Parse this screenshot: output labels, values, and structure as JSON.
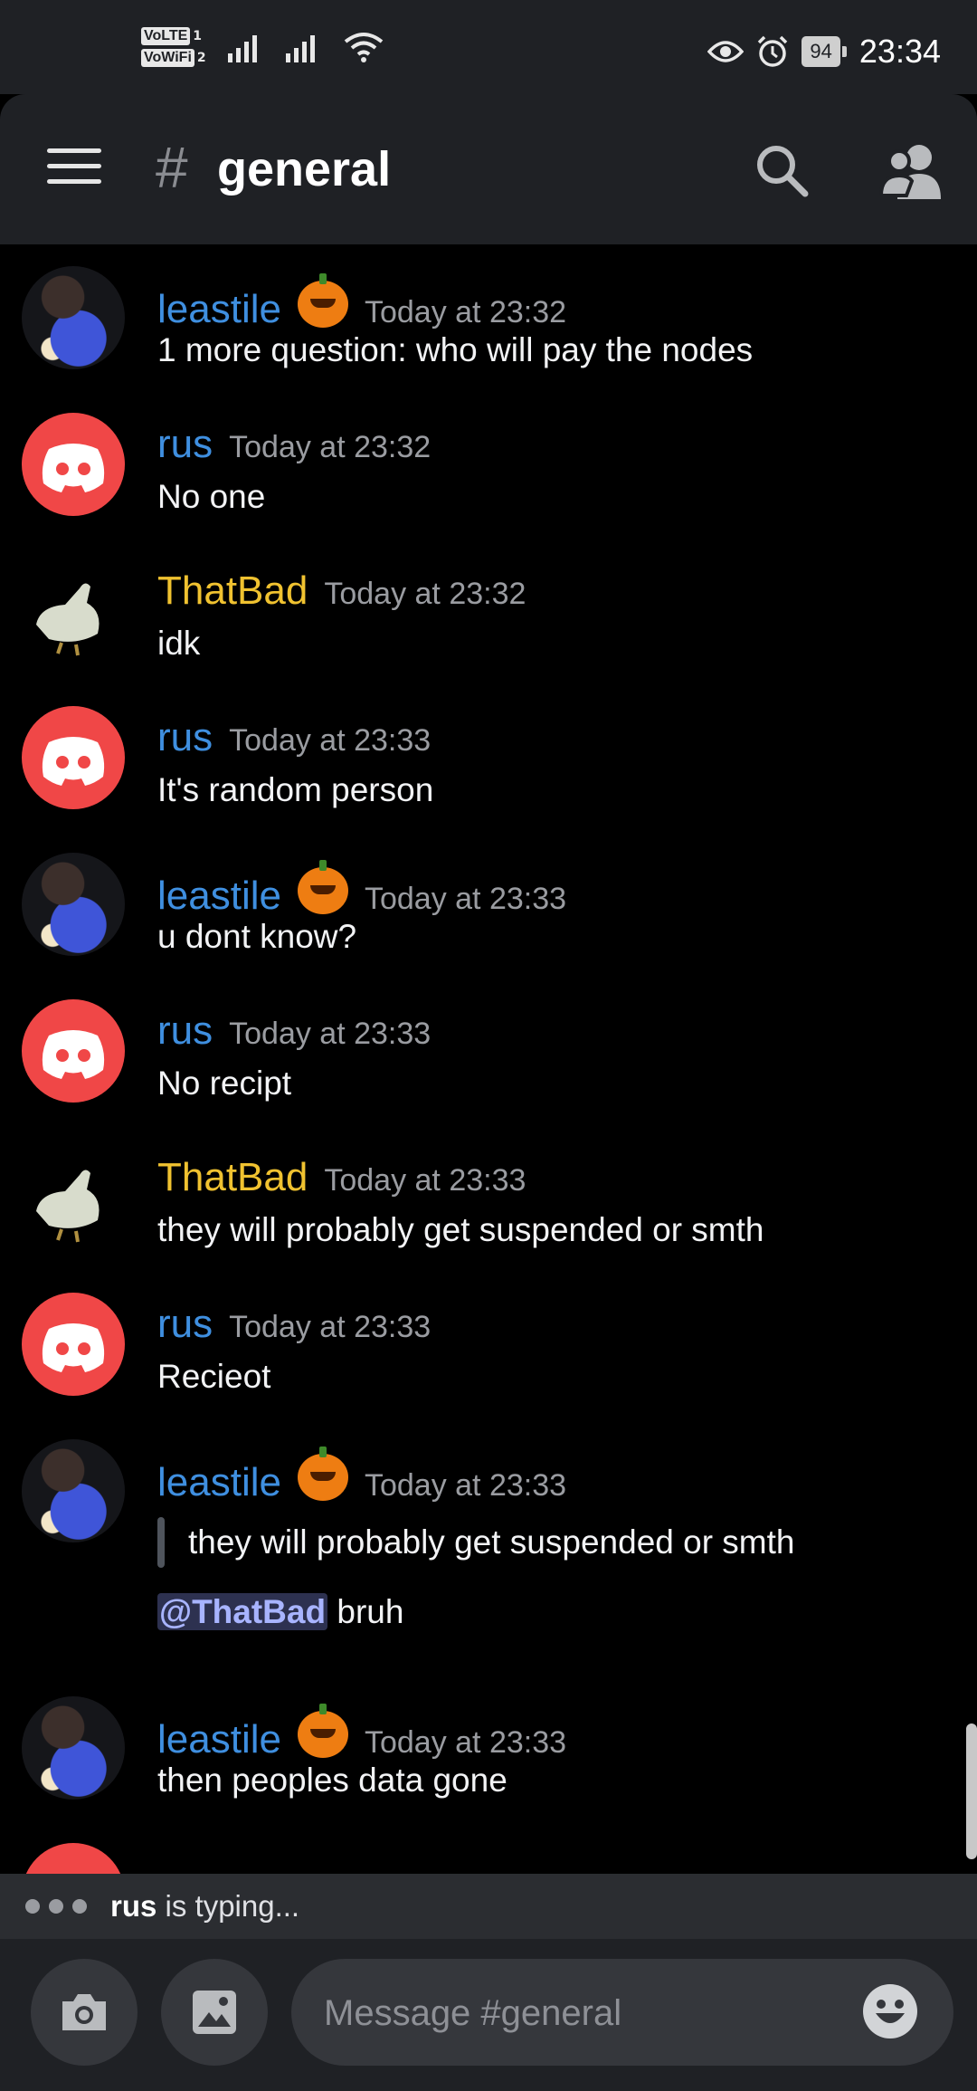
{
  "status_bar": {
    "volte_label": "VoLTE",
    "volte_sim": "1",
    "vowifi_label": "VoWiFi",
    "vowifi_sim": "2",
    "battery": "94",
    "time": "23:34"
  },
  "header": {
    "hash_symbol": "#",
    "channel_name": "general"
  },
  "messages": [
    {
      "author": "leastile",
      "badge": "pumpkin",
      "timestamp": "Today at 23:32",
      "text": "1 more question: who will pay the nodes"
    },
    {
      "author": "rus",
      "timestamp": "Today at 23:32",
      "text": "No one"
    },
    {
      "author": "ThatBad",
      "timestamp": "Today at 23:32",
      "text": "idk"
    },
    {
      "author": "rus",
      "timestamp": "Today at 23:33",
      "text": "It's random person"
    },
    {
      "author": "leastile",
      "badge": "pumpkin",
      "timestamp": "Today at 23:33",
      "text": "u dont know?"
    },
    {
      "author": "rus",
      "timestamp": "Today at 23:33",
      "text": "No recipt"
    },
    {
      "author": "ThatBad",
      "timestamp": "Today at 23:33",
      "text": "they will probably get suspended or smth"
    },
    {
      "author": "rus",
      "timestamp": "Today at 23:33",
      "text": "Recieot"
    },
    {
      "author": "leastile",
      "badge": "pumpkin",
      "timestamp": "Today at 23:33",
      "quote": "they will probably get suspended or smth",
      "mention": "@ThatBad",
      "text": " bruh"
    },
    {
      "author": "leastile",
      "badge": "pumpkin",
      "timestamp": "Today at 23:33",
      "text": "then peoples data gone"
    }
  ],
  "colors": {
    "username_blue": "#3f8fe0",
    "username_yellow": "#f0c230",
    "discord_red": "#f04747"
  },
  "typing": {
    "user": "rus",
    "suffix": " is typing..."
  },
  "composer": {
    "placeholder": "Message #general",
    "camera_icon": "camera-icon",
    "gallery_icon": "image-icon",
    "emoji_icon": "emoji-icon"
  }
}
